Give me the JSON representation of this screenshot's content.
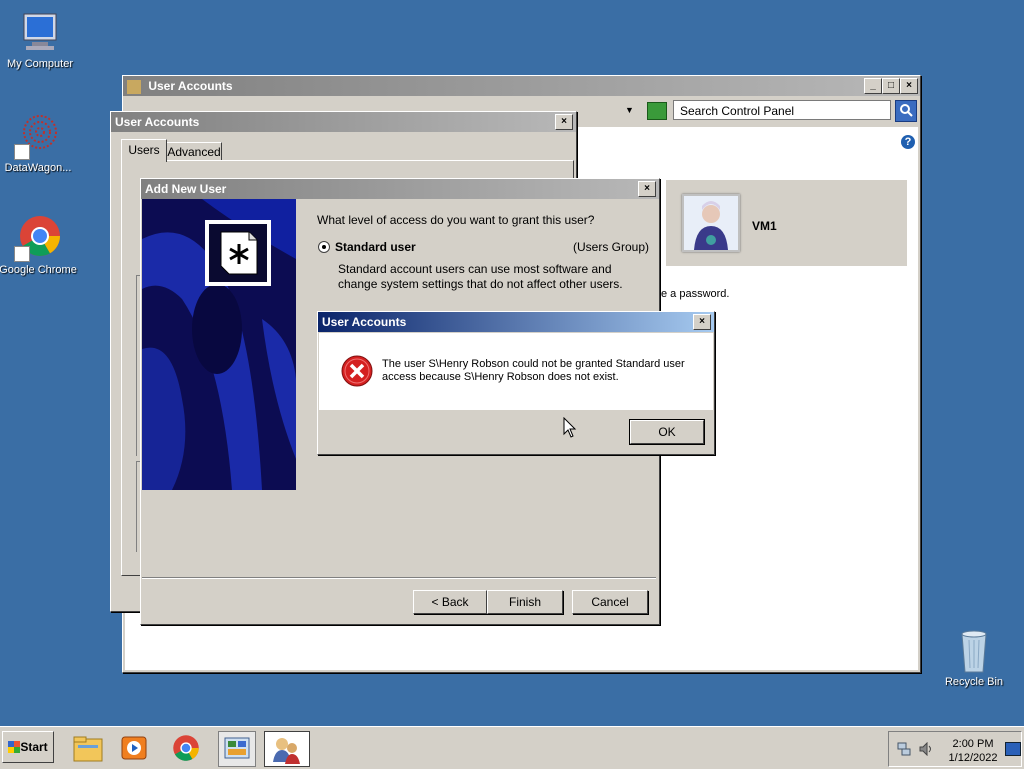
{
  "desktop": {
    "icons": [
      {
        "label": "My Computer"
      },
      {
        "label": "DataWagon..."
      },
      {
        "label": "Google Chrome"
      },
      {
        "label": "Recycle Bin"
      }
    ]
  },
  "cp_window": {
    "title": "User Accounts",
    "search_placeholder": "Search Control Panel",
    "user_name": "VM1",
    "partial_text": "e a password."
  },
  "ua_dialog": {
    "title": "User Accounts",
    "tabs": [
      "Users",
      "Advanced"
    ]
  },
  "wizard": {
    "title": "Add New User",
    "question": "What level of access do you want to grant this user?",
    "option_label": "Standard user",
    "option_group": "(Users Group)",
    "option_desc": "Standard account users can use most software and change system settings that do not affect other users.",
    "back_label": "< Back",
    "finish_label": "Finish",
    "cancel_label": "Cancel"
  },
  "error_dialog": {
    "title": "User Accounts",
    "message": "The user S\\Henry Robson could not be granted Standard user access because S\\Henry Robson does not exist.",
    "ok_label": "OK"
  },
  "taskbar": {
    "start_label": "Start",
    "time": "2:00 PM",
    "date": "1/12/2022"
  }
}
